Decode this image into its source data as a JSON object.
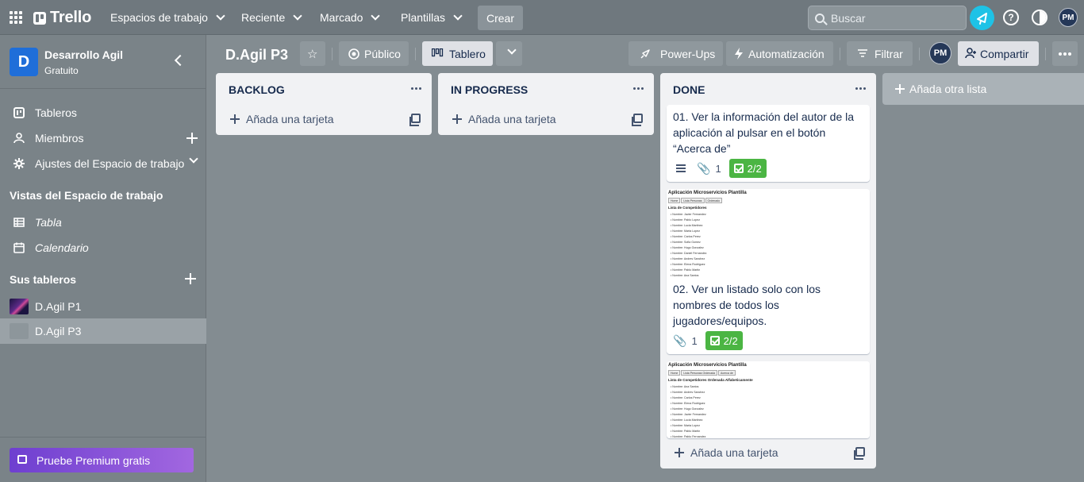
{
  "nav": {
    "logo": "Trello",
    "menus": [
      "Espacios de trabajo",
      "Reciente",
      "Marcado",
      "Plantillas"
    ],
    "create": "Crear",
    "search_placeholder": "Buscar",
    "help": "?",
    "user_initials": "PM"
  },
  "sidebar": {
    "workspace_initial": "D",
    "workspace_name": "Desarrollo Agil",
    "workspace_plan": "Gratuito",
    "items": [
      {
        "label": "Tableros",
        "icon": "trello-board-icon"
      },
      {
        "label": "Miembros",
        "icon": "person-icon"
      },
      {
        "label": "Ajustes del Espacio de trabajo",
        "icon": "gear-icon"
      }
    ],
    "views_heading": "Vistas del Espacio de trabajo",
    "views": [
      {
        "label": "Tabla",
        "icon": "table-icon"
      },
      {
        "label": "Calendario",
        "icon": "calendar-icon"
      }
    ],
    "boards_heading": "Sus tableros",
    "boards": [
      {
        "label": "D.Agil P1",
        "active": false
      },
      {
        "label": "D.Agil P3",
        "active": true
      }
    ],
    "premium": "Pruebe Premium gratis"
  },
  "board": {
    "title": "D.Agil P3",
    "visibility": "Público",
    "view": "Tablero",
    "powerups": "Power-Ups",
    "automation": "Automatización",
    "filter": "Filtrar",
    "member_initials": "PM",
    "share": "Compartir",
    "add_list": "Añada otra lista"
  },
  "lists": [
    {
      "title": "BACKLOG",
      "add_card": "Añada una tarjeta"
    },
    {
      "title": "IN PROGRESS",
      "add_card": "Añada una tarjeta"
    },
    {
      "title": "DONE",
      "add_card": "Añada una tarjeta",
      "cards": [
        {
          "title": "01. Ver la información del autor de la aplicación al pulsar en el botón “Acerca de”",
          "attachments": "1",
          "checklist": "2/2",
          "has_description": true
        },
        {
          "title": "02. Ver un listado solo con los nombres de todos los jugadores/equipos.",
          "attachments": "1",
          "checklist": "2/2",
          "has_description": false
        }
      ]
    }
  ],
  "cover1": {
    "title": "Aplicación Microservicios Plantilla",
    "tabs": [
      "Home",
      "Lista Personas",
      "Ordenado"
    ],
    "subtitle": "Lista de Competidores",
    "rows": [
      "• Nombre: Javier Fernandez",
      "• Nombre: Pablo Lopez",
      "• Nombre: Lucia Martinez",
      "• Nombre: Marta Lopez",
      "• Nombre: Carlos Perez",
      "• Nombre: Sofia Gomez",
      "• Nombre: Hugo Gonzalez",
      "• Nombre: Daniel Fernandez",
      "• Nombre: Andres Sanchez",
      "• Nombre: Elena Rodriguez",
      "• Nombre: Pablo Martin",
      "• Nombre: Ana Santos"
    ]
  },
  "cover2": {
    "title": "Aplicación Microservicios Plantilla",
    "tabs": [
      "Home",
      "Lista Personas Ordenada",
      "Acerca de"
    ],
    "subtitle": "Lista de Competidores Ordenada Alfabeticamente",
    "rows": [
      "• Nombre: Ana Santos",
      "• Nombre: Andres Sanchez",
      "• Nombre: Carlos Perez",
      "• Nombre: Elena Rodriguez",
      "• Nombre: Hugo Gonzalez",
      "• Nombre: Javier Fernandez",
      "• Nombre: Lucia Martinez",
      "• Nombre: Marta Lopez",
      "• Nombre: Pablo Martin",
      "• Nombre: Pablo Fernandez"
    ]
  },
  "colors": {
    "notification": "#1ec2e6",
    "workspace_badge": "#1f6ed9",
    "checklist_complete": "#4bb543",
    "premium_gradient": [
      "#6e3fd0",
      "#a267e0"
    ]
  }
}
